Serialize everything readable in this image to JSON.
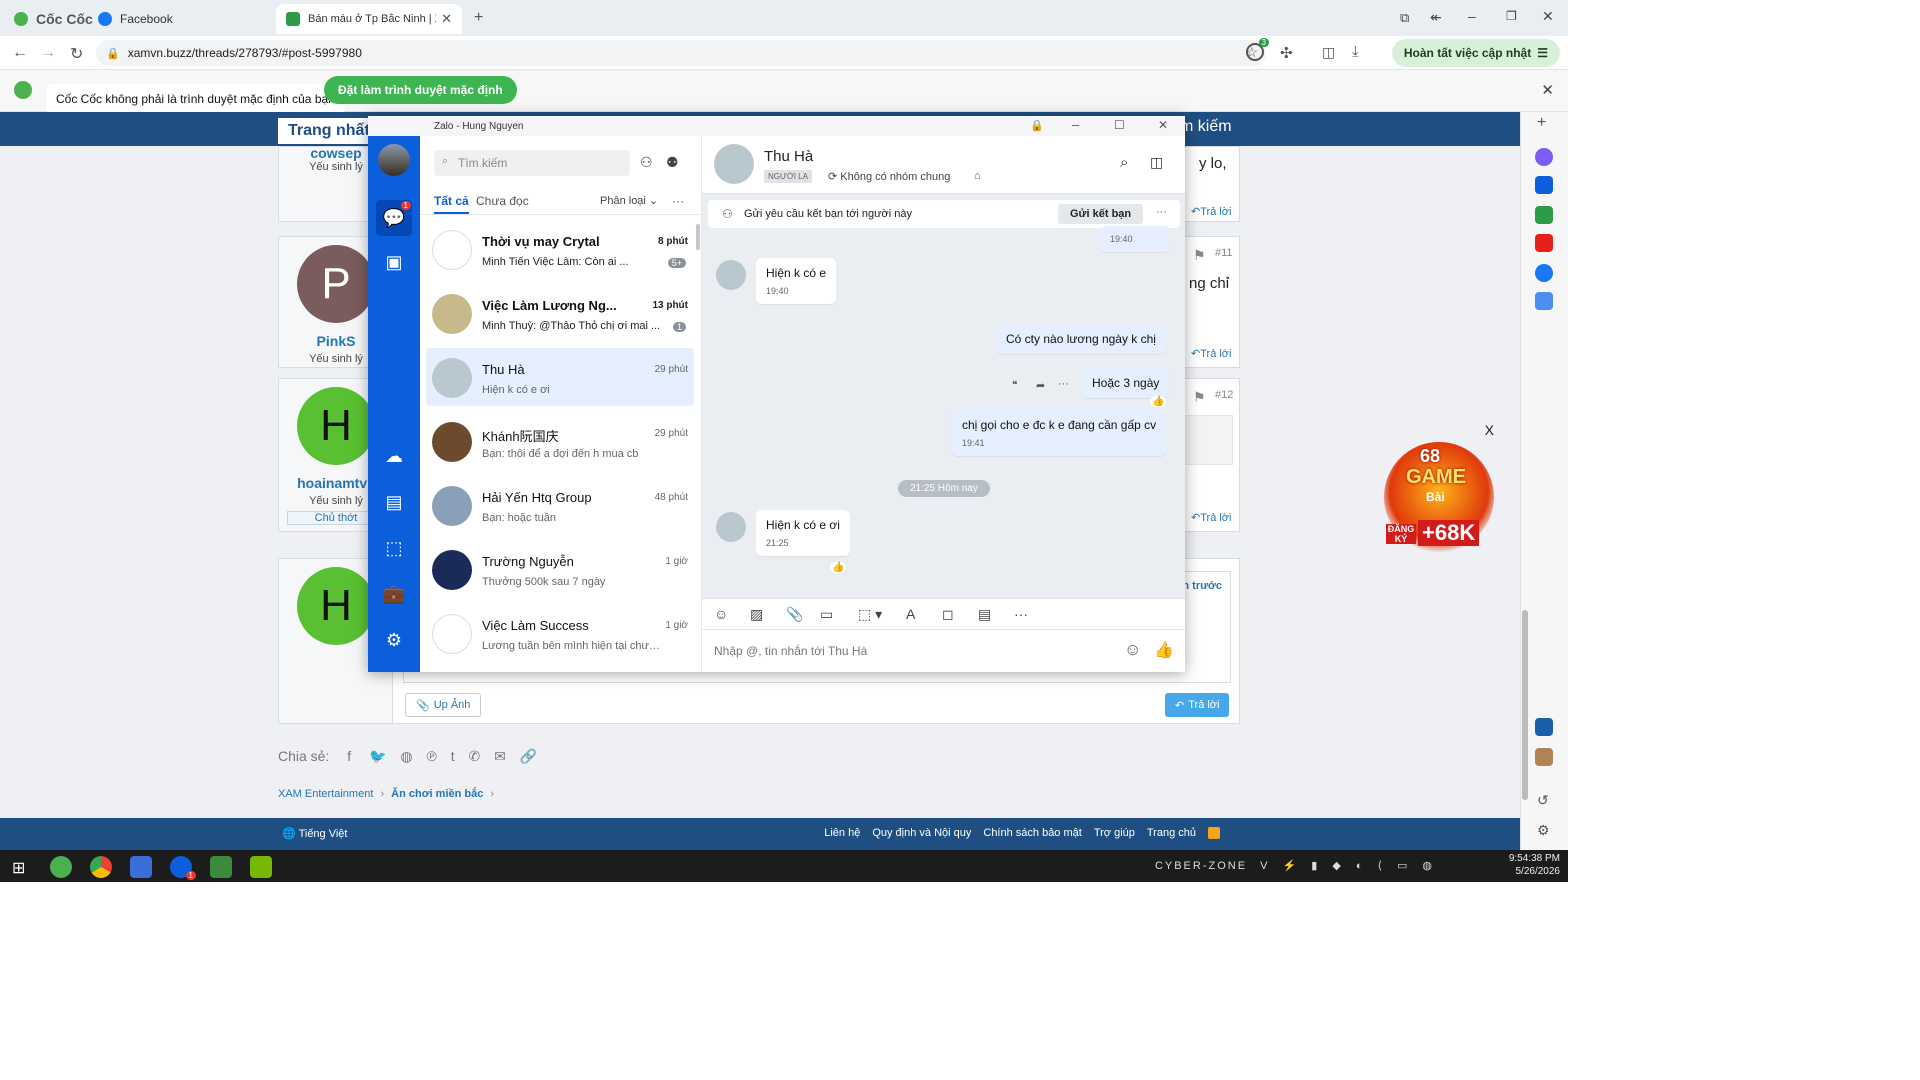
{
  "browser": {
    "tabs": [
      {
        "label": "Cốc Cốc"
      },
      {
        "label": "Facebook"
      },
      {
        "label": "Bán máu ở Tp Bắc Ninh | Xa"
      }
    ],
    "url": "xamvn.buzz/threads/278793/#post-5997980",
    "update_button": "Hoàn tất việc cập nhật",
    "extension_badge": "3",
    "infobar_message": "Cốc Cốc không phải là trình duyệt mặc định của bạn",
    "infobar_button": "Đặt làm trình duyệt mặc định"
  },
  "site": {
    "nav_home": "Trang nhất",
    "nav_search": "m kiếm",
    "posts": [
      {
        "user": "cowsep",
        "role": "Yếu sinh lý",
        "snippet": "y lo,",
        "reply": "Trả lời",
        "number": ""
      },
      {
        "user": "PinkS",
        "avatar_letter": "P",
        "role": "Yếu sinh lý",
        "snippet": "ng chỉ",
        "reply": "Trả lời",
        "number": "#11"
      },
      {
        "user": "hoainamtvk",
        "avatar_letter": "H",
        "role": "Yếu sinh lý",
        "badge": "Chủ thớt",
        "reply": "Trả lời",
        "number": "#12"
      },
      {
        "avatar_letter": "H",
        "prev": "n trước"
      }
    ],
    "upload_button": "Up Ảnh",
    "reply_button": "Trả lời",
    "share_label": "Chia sẻ:",
    "breadcrumb": [
      "XAM Entertainment",
      "Ăn chơi miền bắc"
    ],
    "footer_language": "Tiếng Việt",
    "footer_links": [
      "Liên hệ",
      "Quy định và Nội quy",
      "Chính sách bảo mật",
      "Trợ giúp",
      "Trang chủ"
    ]
  },
  "ad": {
    "close": "X",
    "text_top": "68",
    "text_game": "GAME",
    "text_bai": "Bài",
    "text_signup": "ĐĂNG KÝ",
    "text_bonus": "+68K"
  },
  "zalo": {
    "window_title": "Zalo - Hung Nguyen",
    "rail_badge": "1",
    "search_placeholder": "Tìm kiếm",
    "tab_all": "Tất cả",
    "tab_unread": "Chưa đọc",
    "classify": "Phân loại",
    "conversations": [
      {
        "name": "Thời vụ may Crytal",
        "time": "8 phút",
        "preview": "Minh Tiến Việc Làm: Còn ai ...",
        "badge": "5+"
      },
      {
        "name": "Việc Làm Lương Ng...",
        "time": "13 phút",
        "preview": "Minh Thuỳ: @Thảo Thỏ chị ơi mai ...",
        "badge": "1"
      },
      {
        "name": "Thu Hà",
        "time": "29 phút",
        "preview": "Hiện k có e ơi"
      },
      {
        "name": "Khánh阮国庆",
        "time": "29 phút",
        "preview": "Bạn: thôi để a đợi đến h mua cb"
      },
      {
        "name": "Hải Yến Htq Group",
        "time": "48 phút",
        "preview": "Bạn: hoặc tuần"
      },
      {
        "name": "Trường Nguyễn",
        "time": "1 giờ",
        "preview": "Thưởng 500k sau 7 ngày"
      },
      {
        "name": "Việc Làm Success",
        "time": "1 giờ",
        "preview": "Lương tuần bên mình hiện tại chưa ..."
      }
    ],
    "chat": {
      "name": "Thu Hà",
      "stranger_tag": "NGƯỜI LẠ",
      "common_groups": "Không có nhóm chung",
      "friend_request_text": "Gửi yêu cầu kết bạn tới người này",
      "friend_request_button": "Gửi kết bạn",
      "messages": [
        {
          "text": "",
          "time": "19:40"
        },
        {
          "text": "Hiện k có e",
          "time": "19:40"
        },
        {
          "text": "Có cty nào lương ngày k chị",
          "time": ""
        },
        {
          "text": "Hoặc 3 ngày",
          "time": ""
        },
        {
          "text": "chị gọi cho e đc k e đang cần gấp cv",
          "time": "19:41"
        },
        {
          "text": "Hiện k có e ơi",
          "time": "21:25"
        }
      ],
      "date_separator": "21:25 Hôm nay",
      "input_placeholder": "Nhập @, tin nhắn tới Thu Hà"
    }
  },
  "taskbar": {
    "tray_text": "CYBER-ZONE",
    "time": "9:54:38 PM",
    "date": "5/26/2026",
    "zalo_badge": "1"
  }
}
